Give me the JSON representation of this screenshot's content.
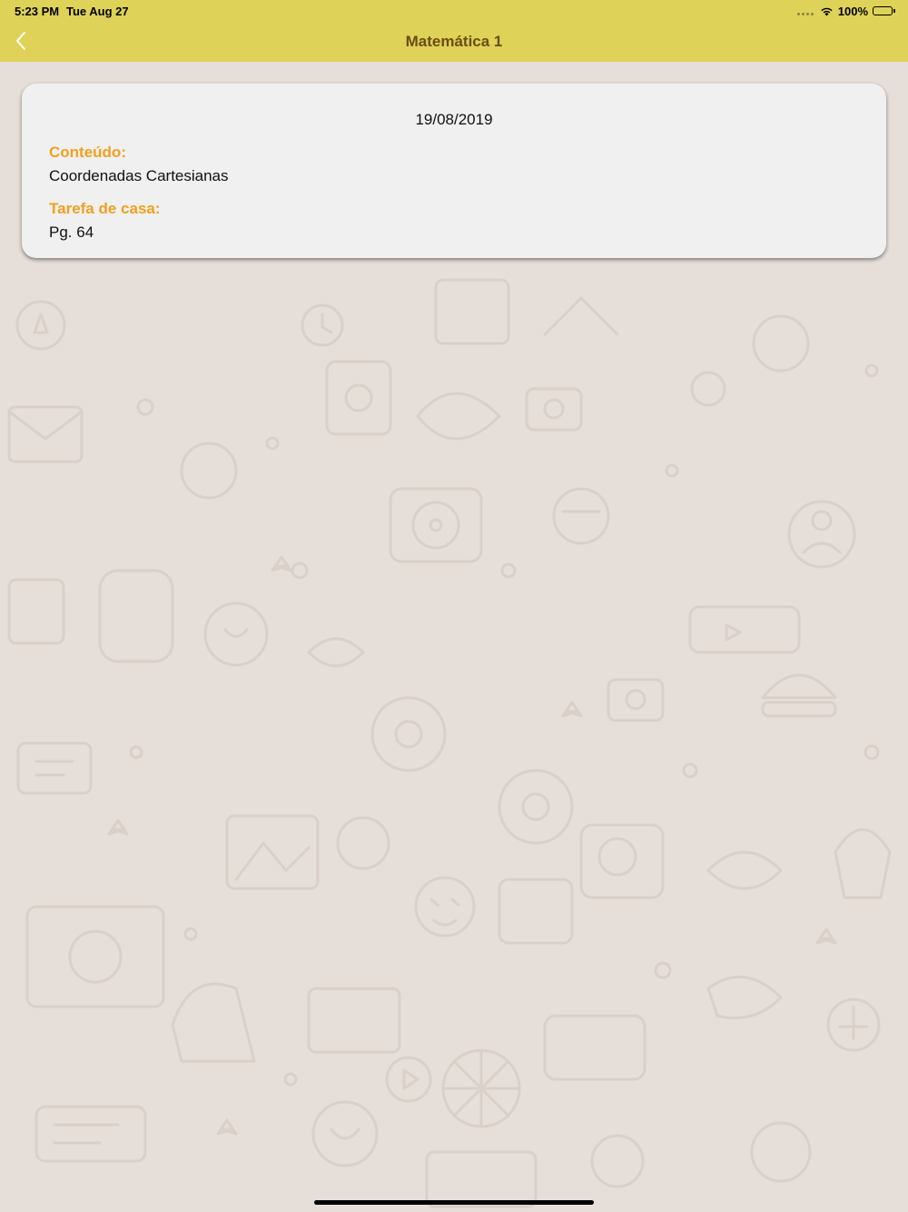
{
  "status_bar": {
    "time": "5:23 PM",
    "date": "Tue Aug 27",
    "battery": "100%",
    "battery_level": 1.0
  },
  "nav": {
    "title": "Matemática 1",
    "back_icon": "chevron-left-icon"
  },
  "colors": {
    "nav_background": "#ded258",
    "title_color": "#6b4d12",
    "label_color": "#f0a020",
    "wallpaper": "#e6ded8",
    "card_background": "#f0f0f0"
  },
  "lesson": {
    "date": "19/08/2019",
    "content_label": "Conteúdo:",
    "content_value": "Coordenadas Cartesianas",
    "homework_label": "Tarefa de casa:",
    "homework_value": "Pg. 64"
  }
}
